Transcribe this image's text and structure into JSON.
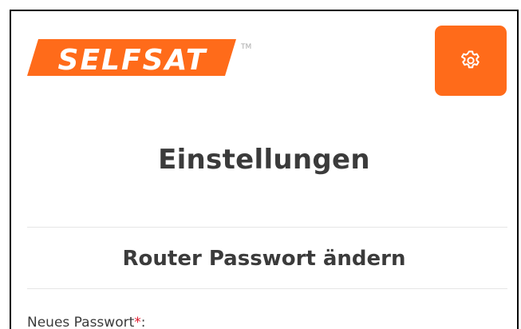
{
  "brand": {
    "logo_text": "SELFSAT",
    "trademark": "TM",
    "accent_color": "#ff6b1a"
  },
  "header": {
    "settings_button_icon": "gear-icon"
  },
  "page": {
    "title": "Einstellungen"
  },
  "section": {
    "title": "Router Passwort ändern"
  },
  "form": {
    "new_password_label": "Neues Passwort",
    "required_marker": "*",
    "label_suffix": ":"
  }
}
